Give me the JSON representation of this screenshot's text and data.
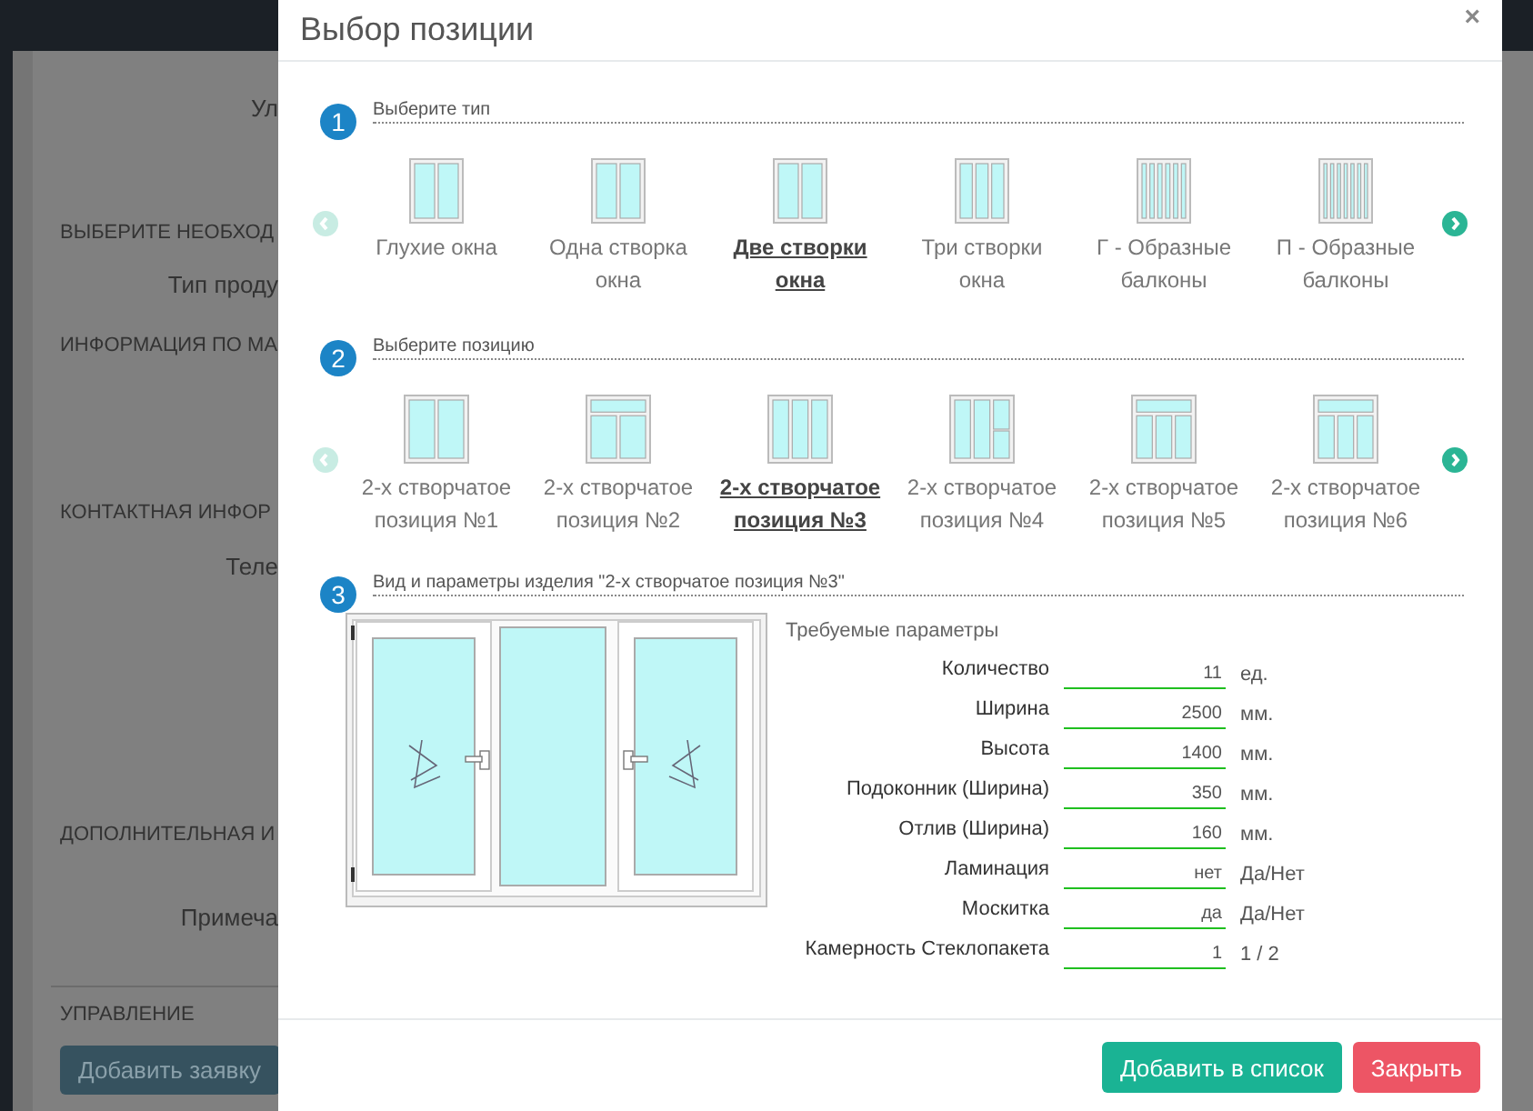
{
  "background": {
    "items": [
      {
        "kind": "label",
        "text": "Ул"
      },
      {
        "kind": "heading",
        "text": "ВЫБЕРИТЕ НЕОБХОД"
      },
      {
        "kind": "label",
        "text": "Тип проду"
      },
      {
        "kind": "heading",
        "text": "ИНФОРМАЦИЯ ПО МА"
      },
      {
        "kind": "heading",
        "text": "КОНТАКТНАЯ ИНФОР"
      },
      {
        "kind": "label",
        "text": "Теле"
      },
      {
        "kind": "heading",
        "text": "ДОПОЛНИТЕЛЬНАЯ И"
      },
      {
        "kind": "label",
        "text": "Примеча"
      },
      {
        "kind": "heading",
        "text": "УПРАВЛЕНИЕ"
      }
    ],
    "button": "Добавить заявку"
  },
  "modal": {
    "title": "Выбор позиции",
    "close": "×",
    "steps": [
      {
        "number": "1",
        "label": "Выберите тип",
        "items": [
          {
            "label": "Глухие окна",
            "selected": false
          },
          {
            "label": "Одна створка окна",
            "selected": false
          },
          {
            "label": "Две створки окна",
            "selected": true
          },
          {
            "label": "Три створки окна",
            "selected": false
          },
          {
            "label": "Г - Образные балконы",
            "selected": false
          },
          {
            "label": "П - Образные балконы",
            "selected": false
          }
        ]
      },
      {
        "number": "2",
        "label": "Выберите позицию",
        "items": [
          {
            "label": "2-х створчатое позиция №1",
            "selected": false
          },
          {
            "label": "2-х створчатое позиция №2",
            "selected": false
          },
          {
            "label": "2-х створчатое позиция №3",
            "selected": true
          },
          {
            "label": "2-х створчатое позиция №4",
            "selected": false
          },
          {
            "label": "2-х створчатое позиция №5",
            "selected": false
          },
          {
            "label": "2-х створчатое позиция №6",
            "selected": false
          }
        ]
      },
      {
        "number": "3",
        "label": "Вид и параметры изделия \"2-х створчатое позиция №3\""
      }
    ],
    "params_title": "Требуемые параметры",
    "params": [
      {
        "label": "Количество",
        "value": "11",
        "unit": "ед."
      },
      {
        "label": "Ширина",
        "value": "2500",
        "unit": "мм."
      },
      {
        "label": "Высота",
        "value": "1400",
        "unit": "мм."
      },
      {
        "label": "Подоконник (Ширина)",
        "value": "350",
        "unit": "мм."
      },
      {
        "label": "Отлив (Ширина)",
        "value": "160",
        "unit": "мм."
      },
      {
        "label": "Ламинация",
        "value": "нет",
        "unit": "Да/Нет"
      },
      {
        "label": "Москитка",
        "value": "да",
        "unit": "Да/Нет"
      },
      {
        "label": "Камерность Стеклопакета",
        "value": "1",
        "unit": "1 / 2"
      }
    ],
    "buttons": [
      {
        "kind": "primary",
        "label": "Добавить в список"
      },
      {
        "kind": "danger",
        "label": "Закрыть"
      }
    ]
  }
}
